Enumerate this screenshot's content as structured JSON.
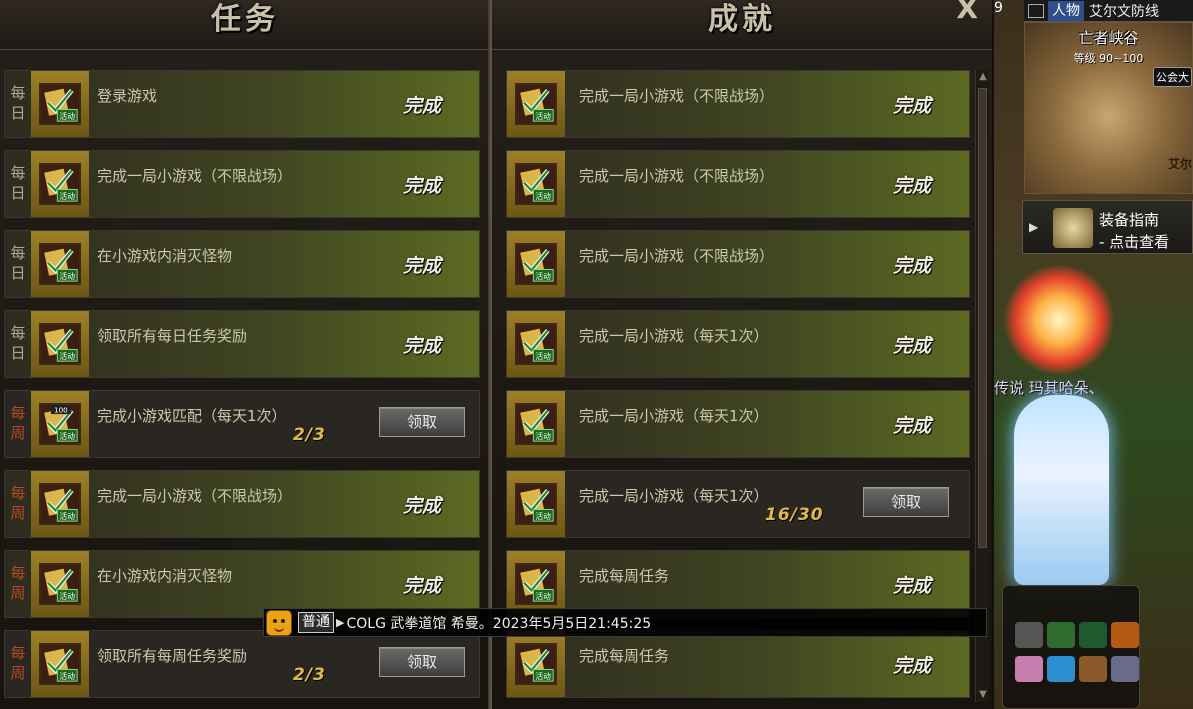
{
  "quest_panel": {
    "title": "任务",
    "rows": [
      {
        "period": "每\n日",
        "name": "登录游戏",
        "state": "done",
        "status": "完成"
      },
      {
        "period": "每\n日",
        "name": "完成一局小游戏（不限战场）",
        "state": "done",
        "status": "完成"
      },
      {
        "period": "每\n日",
        "name": "在小游戏内消灭怪物",
        "state": "done",
        "status": "完成"
      },
      {
        "period": "每\n日",
        "name": "领取所有每日任务奖励",
        "state": "done",
        "status": "完成"
      },
      {
        "period": "每\n周",
        "name": "完成小游戏匹配（每天1次）",
        "state": "claim",
        "progress": "2/3",
        "button": "领取",
        "badge": "100"
      },
      {
        "period": "每\n周",
        "name": "完成一局小游戏（不限战场）",
        "state": "done",
        "status": "完成"
      },
      {
        "period": "每\n周",
        "name": "在小游戏内消灭怪物",
        "state": "done",
        "status": "完成"
      },
      {
        "period": "每\n周",
        "name": "领取所有每周任务奖励",
        "state": "claim",
        "progress": "2/3",
        "button": "领取"
      }
    ]
  },
  "achievement_panel": {
    "title": "成就",
    "close": "X",
    "rows": [
      {
        "name": "完成一局小游戏（不限战场）",
        "state": "done",
        "status": "完成"
      },
      {
        "name": "完成一局小游戏（不限战场）",
        "state": "done",
        "status": "完成"
      },
      {
        "name": "完成一局小游戏（不限战场）",
        "state": "done",
        "status": "完成"
      },
      {
        "name": "完成一局小游戏（每天1次）",
        "state": "done",
        "status": "完成"
      },
      {
        "name": "完成一局小游戏（每天1次）",
        "state": "done",
        "status": "完成"
      },
      {
        "name": "完成一局小游戏（每天1次）",
        "state": "claim",
        "progress": "16/30",
        "button": "领取"
      },
      {
        "name": "完成每周任务",
        "state": "done",
        "status": "完成"
      },
      {
        "name": "完成每周任务",
        "state": "done",
        "status": "完成"
      }
    ]
  },
  "icon_label": "活动",
  "chat": {
    "channel": "普通",
    "message": "COLG 武拳道馆 希曼。2023年5月5日21:45:25"
  },
  "side": {
    "number": "9",
    "tab_active": "人物",
    "tab_name": "艾尔文防线",
    "map_title": "亡者峡谷",
    "map_level": "等级 90~100",
    "map_guild": "公会大",
    "map_place": "艾尔",
    "guide_title": "装备指南",
    "guide_sub": "- 点击查看",
    "legend_name": "传说 玛其哈朵、",
    "skills": [
      "suit-icon",
      "sprout-icon",
      "book-icon",
      "levelup-icon",
      "avatar-icon",
      "tp-icon",
      "scroll-icon",
      "gem-icon"
    ]
  }
}
